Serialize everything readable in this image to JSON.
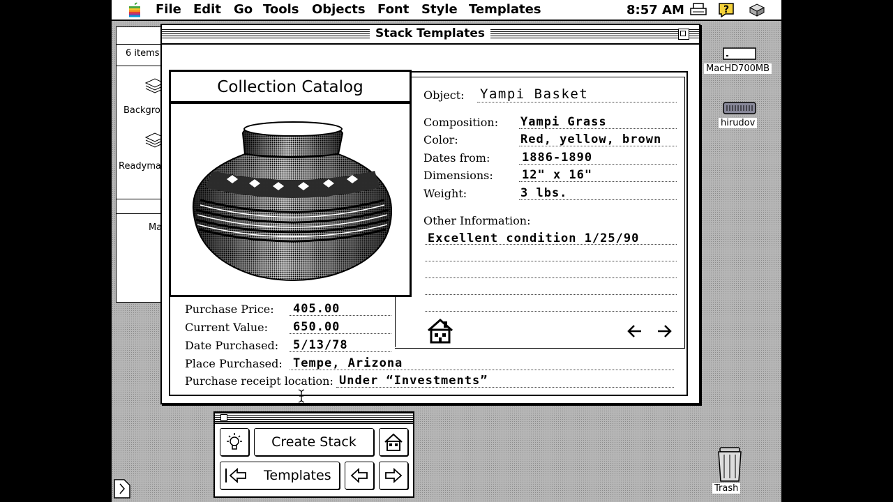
{
  "menubar": {
    "items": [
      "File",
      "Edit",
      "Go",
      "Tools",
      "Objects",
      "Font",
      "Style",
      "Templates"
    ],
    "clock": "8:57 AM",
    "icons": [
      "apple-icon",
      "printer-icon",
      "help-icon",
      "application-icon"
    ]
  },
  "finder": {
    "items_count": "6 items",
    "label1": "Backgro",
    "label2": "Readyma",
    "label3": "Ma"
  },
  "window": {
    "title": "Stack Templates"
  },
  "card": {
    "title": "Collection Catalog",
    "object_label": "Object:",
    "object_value": "Yampi Basket",
    "fields": [
      {
        "label": "Composition:",
        "value": "Yampi Grass"
      },
      {
        "label": "Color:",
        "value": "Red, yellow, brown"
      },
      {
        "label": "Dates from:",
        "value": "1886-1890"
      },
      {
        "label": "Dimensions:",
        "value": "12\" x 16\""
      },
      {
        "label": "Weight:",
        "value": "3 lbs."
      }
    ],
    "other_label": "Other Information:",
    "other_value": "Excellent condition 1/25/90",
    "purchase": [
      {
        "label": "Purchase Price:",
        "value": "405.00"
      },
      {
        "label": "Current Value:",
        "value": "650.00"
      },
      {
        "label": "Date Purchased:",
        "value": "5/13/78"
      },
      {
        "label": "Place Purchased:",
        "value": "Tempe, Arizona"
      },
      {
        "label": "Purchase receipt location:",
        "value": "Under “Investments”"
      }
    ]
  },
  "palette": {
    "create_stack": "Create Stack",
    "templates": "Templates"
  },
  "desktop": {
    "disk1": "MacHD700MB",
    "disk2": "hirudov",
    "trash": "Trash"
  }
}
